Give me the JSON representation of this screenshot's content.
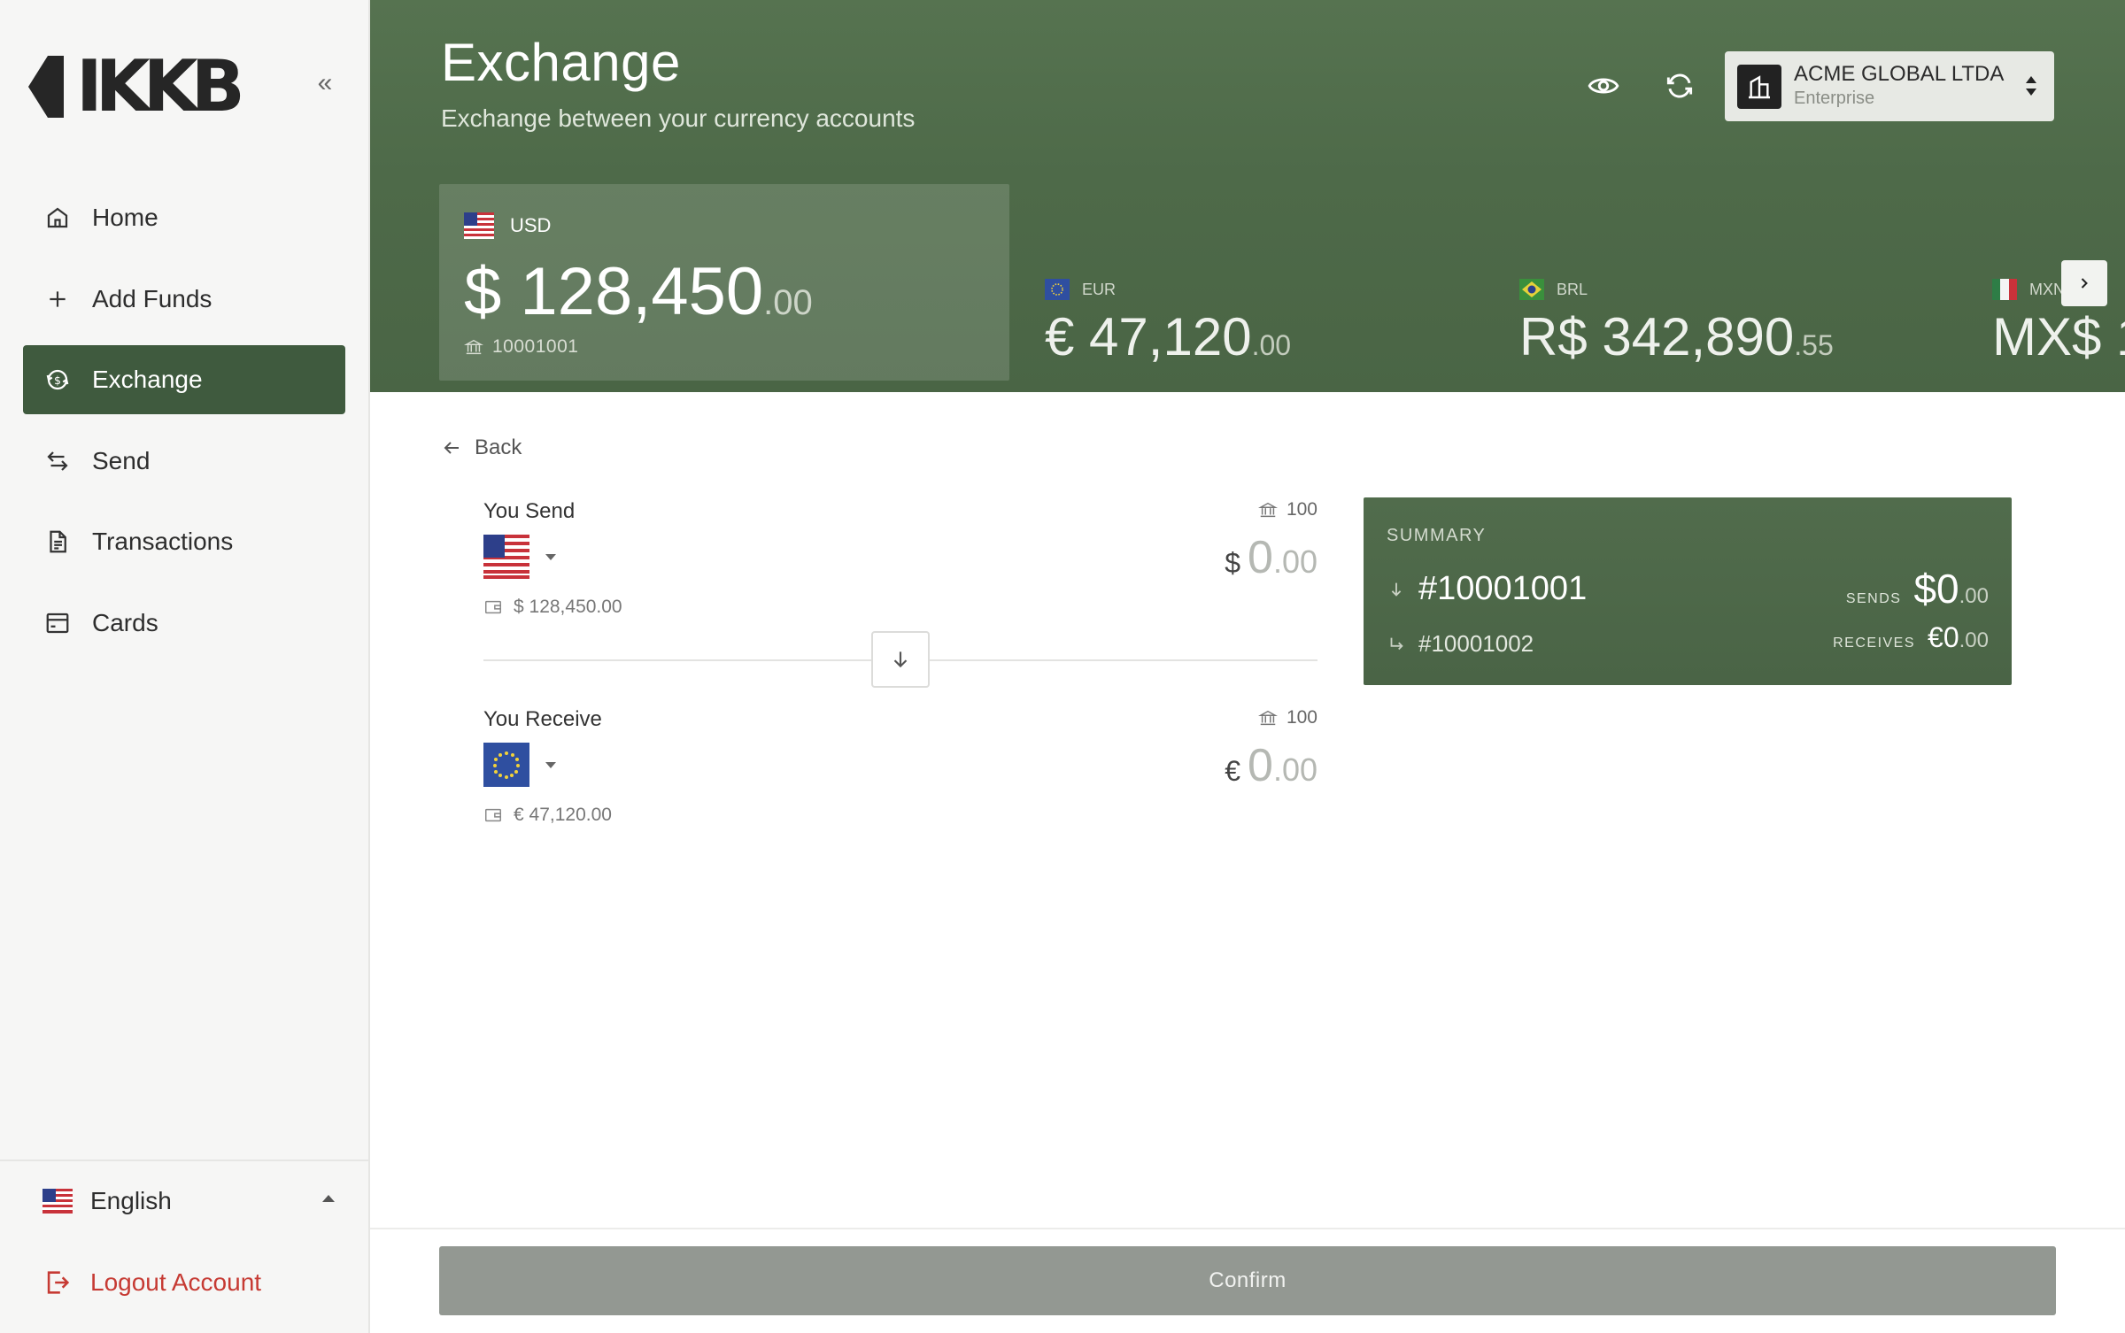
{
  "brand": {
    "logo_text": "IKKB"
  },
  "sidebar": {
    "items": [
      {
        "label": "Home",
        "icon": "home-icon"
      },
      {
        "label": "Add Funds",
        "icon": "plus-icon"
      },
      {
        "label": "Exchange",
        "icon": "exchange-icon",
        "active": true
      },
      {
        "label": "Send",
        "icon": "transfer-arrows-icon"
      },
      {
        "label": "Transactions",
        "icon": "document-icon"
      },
      {
        "label": "Cards",
        "icon": "card-icon"
      }
    ],
    "language": "English",
    "logout": "Logout Account"
  },
  "header": {
    "title": "Exchange",
    "subtitle": "Exchange between your currency accounts",
    "org": {
      "name": "ACME GLOBAL LTDA",
      "type": "Enterprise"
    }
  },
  "accounts": [
    {
      "currency": "USD",
      "symbol": "$",
      "int": "128,450",
      "cents": ".00",
      "account_no": "10001001"
    },
    {
      "currency": "EUR",
      "symbol": "€",
      "int": "47,120",
      "cents": ".00"
    },
    {
      "currency": "BRL",
      "symbol": "R$",
      "int": "342,890",
      "cents": ".55"
    },
    {
      "currency": "MXN",
      "symbol": "MX$",
      "int": "1"
    }
  ],
  "exchange": {
    "back": "Back",
    "send": {
      "label": "You Send",
      "limit": "100",
      "balance": "$ 128,450.00",
      "symbol": "$",
      "int": "0",
      "cents": ".00"
    },
    "receive": {
      "label": "You Receive",
      "limit": "100",
      "balance": "€ 47,120.00",
      "symbol": "€",
      "int": "0",
      "cents": ".00"
    }
  },
  "summary": {
    "title": "SUMMARY",
    "from": "#10001001",
    "to": "#10001002",
    "sends_label": "SENDS",
    "sends_value": "$0",
    "sends_cents": ".00",
    "receives_label": "RECEIVES",
    "receives_value": "€0",
    "receives_cents": ".00"
  },
  "confirm_label": "Confirm",
  "colors": {
    "accent": "#3f5a3e",
    "header": "#4e6a49",
    "danger": "#c63a33",
    "disabled_button": "#939892"
  }
}
